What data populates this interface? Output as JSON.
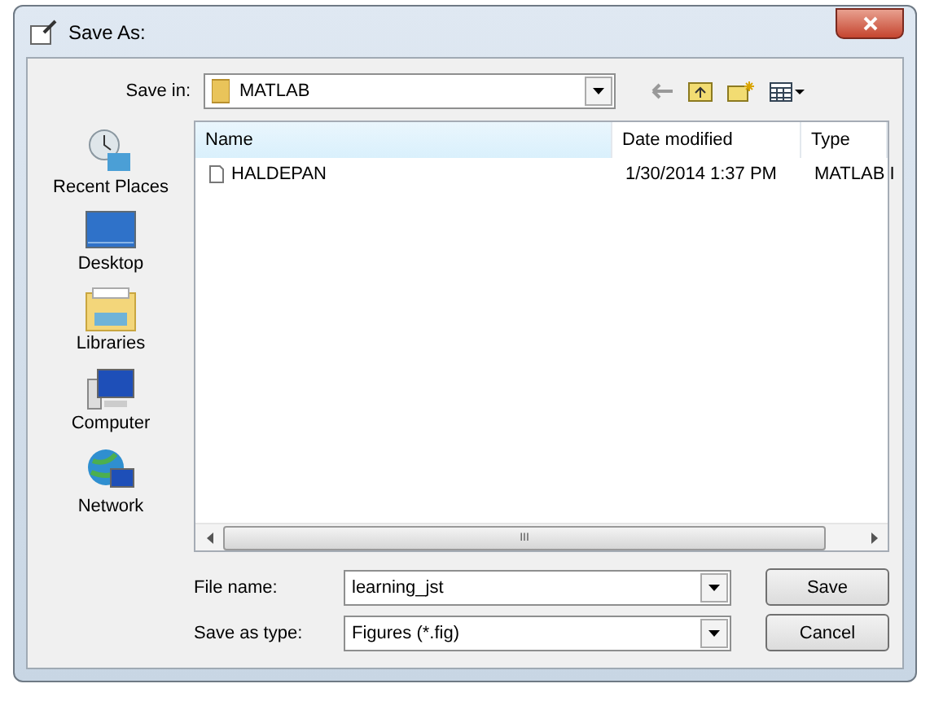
{
  "window": {
    "title": "Save As:"
  },
  "save_in": {
    "label": "Save in:",
    "value": "MATLAB"
  },
  "places": [
    {
      "label": "Recent Places",
      "kind": "recent"
    },
    {
      "label": "Desktop",
      "kind": "desktop"
    },
    {
      "label": "Libraries",
      "kind": "libraries"
    },
    {
      "label": "Computer",
      "kind": "computer"
    },
    {
      "label": "Network",
      "kind": "network"
    }
  ],
  "columns": [
    "Name",
    "Date modified",
    "Type"
  ],
  "files": [
    {
      "name": "HALDEPAN",
      "date": "1/30/2014 1:37 PM",
      "type": "MATLAB I",
      "selected": false
    }
  ],
  "file_name": {
    "label": "File name:",
    "value": "learning_jst"
  },
  "save_as_type": {
    "label": "Save as type:",
    "value": "Figures (*.fig)"
  },
  "buttons": [
    "Save",
    "Cancel"
  ],
  "scroll_grip": "III"
}
